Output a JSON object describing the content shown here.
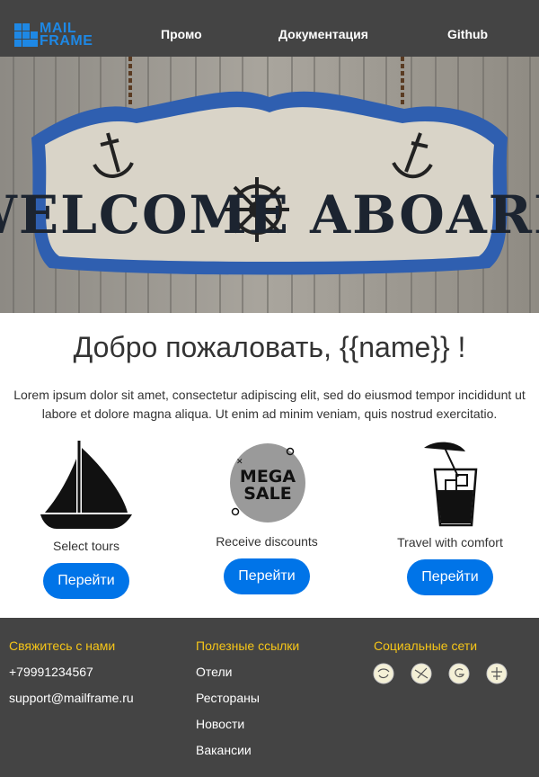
{
  "header": {
    "logo": {
      "line1": "MAIL",
      "line2": "FRAME"
    },
    "nav": [
      "Промо",
      "Документация",
      "Github"
    ]
  },
  "hero": {
    "sign_text": "WELCOME ABOARD"
  },
  "main": {
    "title": "Добро пожаловать, {{name}} !",
    "lead": "Lorem ipsum dolor sit amet, consectetur adipiscing elit, sed do eiusmod tempor incididunt ut labore et dolore magna aliqua. Ut enim ad minim veniam, quis nostrud exercitatio.",
    "features": [
      {
        "caption": "Select tours",
        "button": "Перейти",
        "icon": "sailboat-icon"
      },
      {
        "caption": "Receive discounts",
        "button": "Перейти",
        "icon": "mega-sale-icon",
        "badge_line1": "MEGA",
        "badge_line2": "SALE"
      },
      {
        "caption": "Travel with comfort",
        "button": "Перейти",
        "icon": "cocktail-icon"
      }
    ]
  },
  "footer": {
    "contacts": {
      "heading": "Свяжитесь с нами",
      "phone": "+79991234567",
      "email": "support@mailframe.ru"
    },
    "links": {
      "heading": "Полезные ссылки",
      "items": [
        "Отели",
        "Рестораны",
        "Новости",
        "Вакансии"
      ]
    },
    "social": {
      "heading": "Социальные сети",
      "icons": [
        "social-icon-1",
        "social-icon-2",
        "social-icon-3",
        "social-icon-4"
      ]
    }
  },
  "colors": {
    "header_bg": "#444444",
    "accent": "#0074e8",
    "footer_heading": "#f5c518",
    "logo": "#1e88e5"
  }
}
